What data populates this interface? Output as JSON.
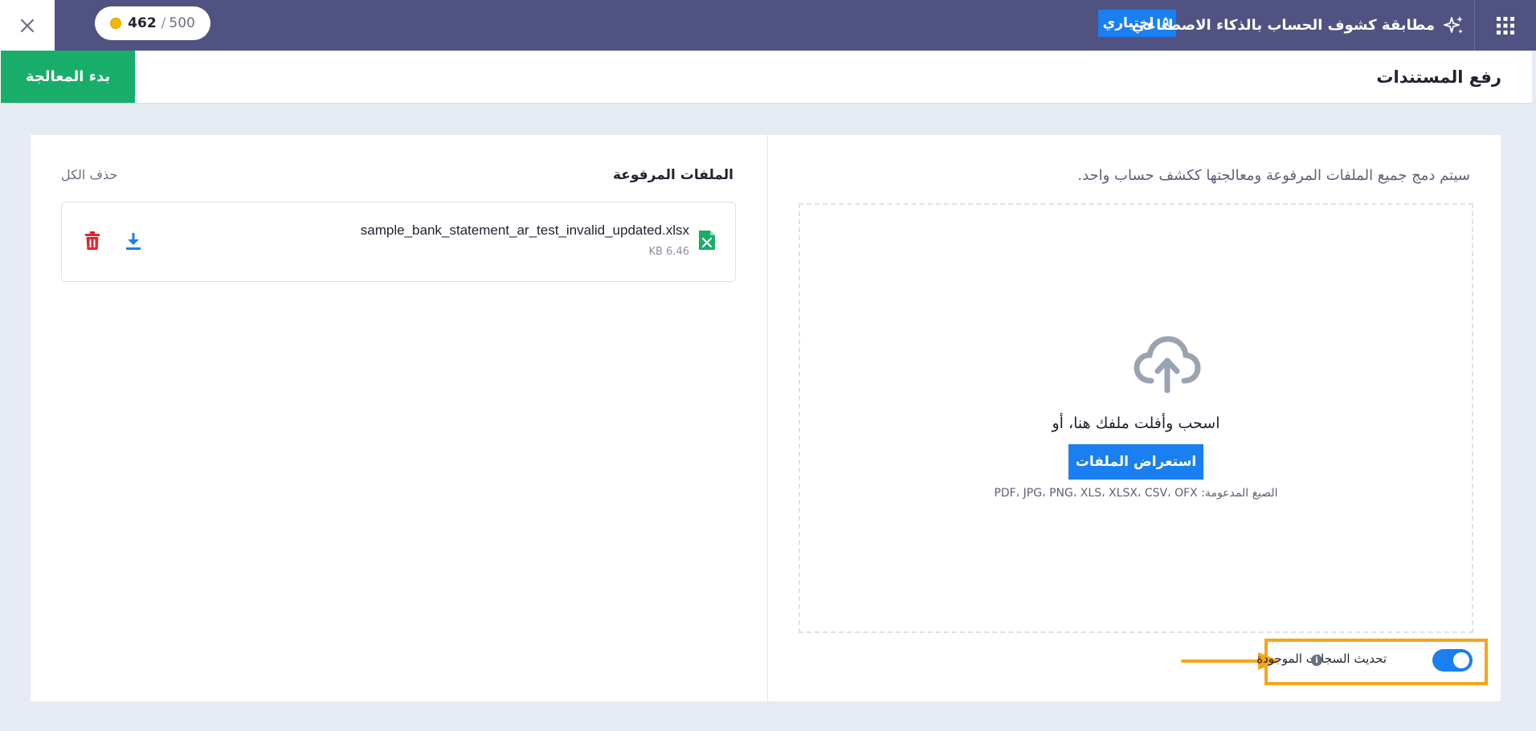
{
  "topbar": {
    "close_icon": "close-icon",
    "credits": {
      "used": "462",
      "total": "500",
      "coin_color": "#f5b800"
    },
    "app_title": "مطابقة كشوف الحساب بالذكاء الاصطناعي",
    "beta_label": "اختباري",
    "grid_icon": "apps-grid-icon",
    "background_color": "#505282"
  },
  "header": {
    "page_title": "رفع المستندات",
    "start_button": "بدء المعالجة",
    "start_button_color": "#19ad6a"
  },
  "upload_panel": {
    "merge_note": "سيتم دمج جميع الملفات المرفوعة ومعالجتها ككشف حساب واحد.",
    "drag_text": "اسحب وأفلت ملفك هنا، أو",
    "browse_button": "استعراض الملفات",
    "formats_label": "الصيغ المدعومة:",
    "formats_list": "PDF، JPG، PNG، XLS، XLSX، CSV، OFX",
    "toggle": {
      "label": "تحديث السجلات الموجودة",
      "enabled": true
    },
    "accent_color": "#1a7ff0",
    "highlight_color": "#f6a51b"
  },
  "files_panel": {
    "heading": "الملفات المرفوعة",
    "delete_all": "حذف الكل",
    "files": [
      {
        "name": "sample_bank_statement_ar_test_invalid_updated.xlsx",
        "size": "6.46 KB",
        "icon": "xlsx-file-icon"
      }
    ]
  }
}
